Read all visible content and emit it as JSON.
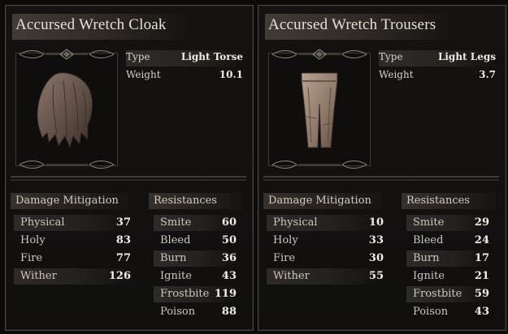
{
  "items": [
    {
      "name": "Accursed Wretch Cloak",
      "type_label": "Type",
      "type_value": "Light Torse",
      "weight_label": "Weight",
      "weight_value": "10.1",
      "art_icon": "cloak-icon",
      "damage_header": "Damage Mitigation",
      "resist_header": "Resistances",
      "damage": [
        {
          "label": "Physical",
          "value": "37"
        },
        {
          "label": "Holy",
          "value": "83"
        },
        {
          "label": "Fire",
          "value": "77"
        },
        {
          "label": "Wither",
          "value": "126"
        }
      ],
      "resist": [
        {
          "label": "Smite",
          "value": "60"
        },
        {
          "label": "Bleed",
          "value": "50"
        },
        {
          "label": "Burn",
          "value": "36"
        },
        {
          "label": "Ignite",
          "value": "43"
        },
        {
          "label": "Frostbite",
          "value": "119"
        },
        {
          "label": "Poison",
          "value": "88"
        }
      ]
    },
    {
      "name": "Accursed Wretch Trousers",
      "type_label": "Type",
      "type_value": "Light Legs",
      "weight_label": "Weight",
      "weight_value": "3.7",
      "art_icon": "trousers-icon",
      "damage_header": "Damage Mitigation",
      "resist_header": "Resistances",
      "damage": [
        {
          "label": "Physical",
          "value": "10"
        },
        {
          "label": "Holy",
          "value": "33"
        },
        {
          "label": "Fire",
          "value": "30"
        },
        {
          "label": "Wither",
          "value": "55"
        }
      ],
      "resist": [
        {
          "label": "Smite",
          "value": "29"
        },
        {
          "label": "Bleed",
          "value": "24"
        },
        {
          "label": "Burn",
          "value": "17"
        },
        {
          "label": "Ignite",
          "value": "21"
        },
        {
          "label": "Frostbite",
          "value": "59"
        },
        {
          "label": "Poison",
          "value": "43"
        }
      ]
    }
  ]
}
